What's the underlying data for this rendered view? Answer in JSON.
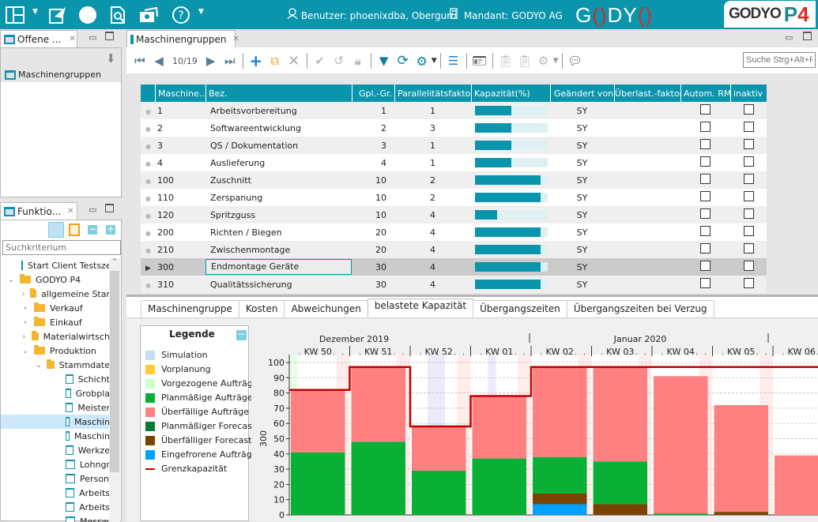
{
  "topbar": {
    "icons": [
      "layout-icon",
      "send-icon",
      "pie-chart-icon",
      "document-search-icon",
      "camera-icon",
      "help-icon"
    ],
    "user_label": "Benutzer: phoenixdba, Oberguru",
    "client_label": "Mandant: GODYO AG",
    "logo_text_pre": "G",
    "logo_text_o": "()",
    "logo_text_post": "DY",
    "logo_text_end": "()",
    "brand_text": "GODYO",
    "brand_p": "P",
    "brand_4": "4",
    "colors": {
      "accent": "#0a95ad",
      "logo_red": "#d52b2b"
    }
  },
  "left_top": {
    "tab_label": "Offene ...",
    "items": [
      {
        "label": "Maschinengruppen"
      }
    ]
  },
  "left_bottom": {
    "tab_label": "Funktio...",
    "search_placeholder": "Suchkriterium",
    "tree": [
      {
        "label": "Start Client Testsze",
        "type": "doc",
        "level": 0
      },
      {
        "label": "GODYO P4",
        "type": "folder",
        "level": 0,
        "expanded": true
      },
      {
        "label": "allgemeine Star",
        "type": "folder",
        "level": 1,
        "expanded": false
      },
      {
        "label": "Verkauf",
        "type": "folder",
        "level": 1,
        "expanded": false
      },
      {
        "label": "Einkauf",
        "type": "folder",
        "level": 1,
        "expanded": false
      },
      {
        "label": "Materialwirtsch",
        "type": "folder",
        "level": 1,
        "expanded": false
      },
      {
        "label": "Produktion",
        "type": "folder",
        "level": 1,
        "expanded": true
      },
      {
        "label": "Stammdate",
        "type": "folder",
        "level": 2,
        "expanded": true
      },
      {
        "label": "Schicht",
        "type": "doc",
        "level": 3
      },
      {
        "label": "Grobpla",
        "type": "doc",
        "level": 3
      },
      {
        "label": "Meister",
        "type": "doc",
        "level": 3
      },
      {
        "label": "Maschin",
        "type": "doc",
        "level": 3,
        "selected": true
      },
      {
        "label": "Maschin",
        "type": "doc",
        "level": 3
      },
      {
        "label": "Werkze",
        "type": "doc",
        "level": 3
      },
      {
        "label": "Lohngr",
        "type": "doc",
        "level": 3
      },
      {
        "label": "Person",
        "type": "doc",
        "level": 3
      },
      {
        "label": "Arbeits",
        "type": "doc",
        "level": 3
      },
      {
        "label": "Arbeits",
        "type": "doc",
        "level": 3
      },
      {
        "label": "Messw",
        "type": "doc",
        "level": 3
      }
    ]
  },
  "main": {
    "tab_label": "Maschinengruppen",
    "record_position": "10/19",
    "search_placeholder": "Suche Strg+Alt+F",
    "columns": [
      "Maschine...",
      "Bez.",
      "Gpl.-Gr.",
      "Parallelitätsfaktor",
      "Kapazität(%)",
      "Geändert von",
      "Überlast.-faktor",
      "Autom. RM",
      "inaktiv"
    ],
    "rows": [
      {
        "id": "1",
        "name": "Arbeitsvorbereitung",
        "gpl": "1",
        "par": "1",
        "cap": 50,
        "by": "SY"
      },
      {
        "id": "2",
        "name": "Softwareentwicklung",
        "gpl": "2",
        "par": "3",
        "cap": 50,
        "by": "SY"
      },
      {
        "id": "3",
        "name": "QS / Dokumentation",
        "gpl": "3",
        "par": "1",
        "cap": 50,
        "by": "SY"
      },
      {
        "id": "4",
        "name": "Auslieferung",
        "gpl": "4",
        "par": "1",
        "cap": 50,
        "by": "SY"
      },
      {
        "id": "100",
        "name": "Zuschnitt",
        "gpl": "10",
        "par": "2",
        "cap": 90,
        "by": "SY"
      },
      {
        "id": "110",
        "name": "Zerspanung",
        "gpl": "10",
        "par": "2",
        "cap": 90,
        "by": "SY"
      },
      {
        "id": "120",
        "name": "Spritzguss",
        "gpl": "10",
        "par": "4",
        "cap": 30,
        "by": "SY"
      },
      {
        "id": "200",
        "name": "Richten / Biegen",
        "gpl": "20",
        "par": "4",
        "cap": 90,
        "by": "SY"
      },
      {
        "id": "210",
        "name": "Zwischenmontage",
        "gpl": "20",
        "par": "4",
        "cap": 90,
        "by": "SY"
      },
      {
        "id": "300",
        "name": "Endmontage Geräte",
        "gpl": "30",
        "par": "4",
        "cap": 90,
        "by": "SY",
        "selected": true
      },
      {
        "id": "310",
        "name": "Qualitätssicherung",
        "gpl": "30",
        "par": "4",
        "cap": 90,
        "by": "SY"
      }
    ],
    "detail_tabs": [
      "Maschinengruppe",
      "Kosten",
      "Abweichungen",
      "belastete Kapazität",
      "Übergangszeiten",
      "Übergangszeiten bei Verzug"
    ],
    "active_detail_tab": 3
  },
  "legend": {
    "title": "Legende",
    "items": [
      {
        "label": "Simulation",
        "color": "#c6dcf7"
      },
      {
        "label": "Vorplanung",
        "color": "#ffcc33"
      },
      {
        "label": "Vorgezogene Aufträge",
        "color": "#ccffcc"
      },
      {
        "label": "Planmäßige Aufträge",
        "color": "#09b036"
      },
      {
        "label": "Überfällige Aufträge",
        "color": "#ff8080"
      },
      {
        "label": "Planmäßiger Forecast",
        "color": "#087a36"
      },
      {
        "label": "Überfälliger Forecast",
        "color": "#7b4200"
      },
      {
        "label": "Eingefrorene Aufträge",
        "color": "#00a2ff"
      },
      {
        "label": "Grenzkapazität",
        "color": "#c00000",
        "line": true
      }
    ]
  },
  "chart_data": {
    "type": "bar",
    "stacked": true,
    "ylabel": "300",
    "ylim": [
      0,
      100
    ],
    "yticks": [
      0,
      10,
      20,
      30,
      40,
      50,
      60,
      70,
      80,
      90,
      100
    ],
    "months": [
      {
        "label": "Dezember 2019"
      },
      {
        "label": "Januar 2020"
      }
    ],
    "categories": [
      "KW 50",
      "KW 51",
      "KW 52",
      "KW 01",
      "KW 02",
      "KW 03",
      "KW 04",
      "KW 05",
      "KW 06"
    ],
    "series": [
      {
        "name": "Eingefrorene Aufträge",
        "color": "#00a2ff",
        "values": [
          0,
          0,
          0,
          0,
          7,
          0,
          0,
          0,
          0
        ]
      },
      {
        "name": "Überfälliger Forecast",
        "color": "#7b4200",
        "values": [
          0,
          0,
          0,
          0,
          7,
          7,
          0,
          2,
          0
        ]
      },
      {
        "name": "Planmäßige Aufträge",
        "color": "#09b036",
        "values": [
          41,
          48,
          29,
          37,
          24,
          28,
          1,
          0,
          0
        ]
      },
      {
        "name": "Überfällige Aufträge",
        "color": "#ff8080",
        "values": [
          41,
          49,
          29,
          41,
          59,
          62,
          90,
          70,
          39
        ]
      }
    ],
    "limit": {
      "name": "Grenzkapazität",
      "color": "#c00000",
      "values": [
        82,
        97,
        58,
        78,
        97,
        97,
        97,
        97,
        97
      ]
    },
    "grid": true
  }
}
